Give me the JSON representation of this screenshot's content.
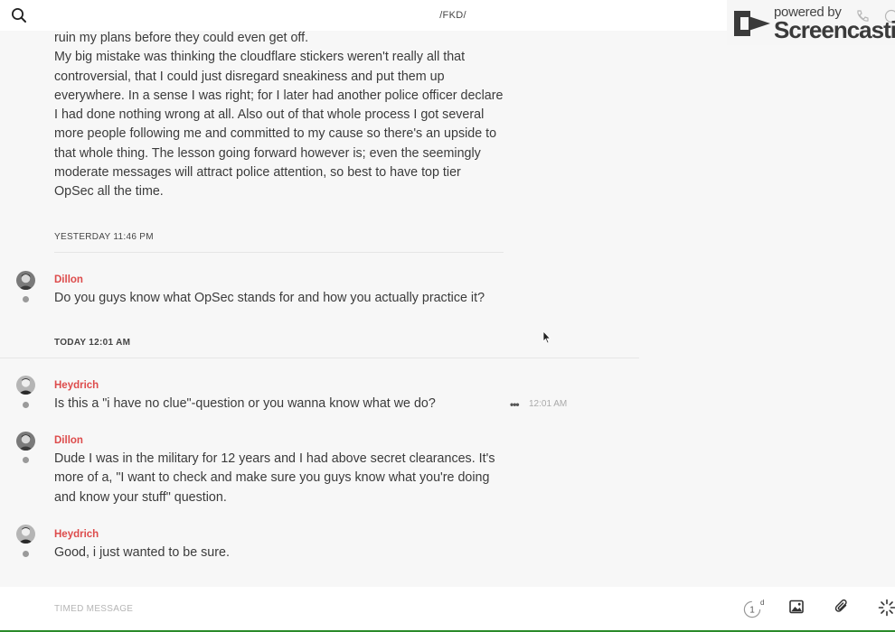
{
  "header": {
    "channel_title": "/FKD/"
  },
  "watermark": {
    "powered_by": "powered by",
    "brand": "Screencastify"
  },
  "messages": {
    "prev_continuation": {
      "lines": [
        "ruin my plans before they could even get off.",
        "My big mistake was thinking the cloudflare stickers weren't really all that",
        "controversial, that I could just disregard sneakiness and put them up",
        "everywhere. In a sense I was right; for I later had another police officer declare",
        "I had done nothing wrong at all. Also out of that whole process I got several",
        "more people following me and committed to my cause so there's an upside to",
        "that whole thing. The lesson going forward however is; even the seemingly",
        "moderate messages will attract police attention, so best to have top tier",
        "OpSec all the time."
      ]
    },
    "day_separators": [
      "YESTERDAY 11:46 PM",
      "TODAY 12:01 AM"
    ],
    "items": [
      {
        "author": "Dillon",
        "lines": [
          "Do you guys know what OpSec stands for and how you actually practice it?"
        ]
      },
      {
        "author": "Heydrich",
        "lines": [
          "Is this a \"i have no clue\"-question or you wanna know what we do?"
        ],
        "time": "12:01 AM",
        "more_glyph": "•••"
      },
      {
        "author": "Dillon",
        "lines": [
          "Dude I was in the military for 12 years and I had above secret clearances. It's",
          "more of a, \"I want to check and make sure you guys know what you're doing",
          "and know your stuff\" question."
        ]
      },
      {
        "author": "Heydrich",
        "lines": [
          "Good, i just wanted to be sure."
        ]
      }
    ]
  },
  "composer": {
    "placeholder": "TIMED MESSAGE",
    "timer_value": "1",
    "timer_unit": "d"
  },
  "icons": {
    "search": "search-icon",
    "watermark_logo": "screencastify-logo",
    "phone": "phone-icon",
    "info": "info-icon",
    "timer": "timer-icon",
    "image": "image-icon",
    "attach": "paperclip-icon",
    "loading": "spinner-icon"
  },
  "colors": {
    "author_name": "#dd4b4b",
    "background": "#f7f7f7",
    "status_dot": "#9a9a9a"
  }
}
